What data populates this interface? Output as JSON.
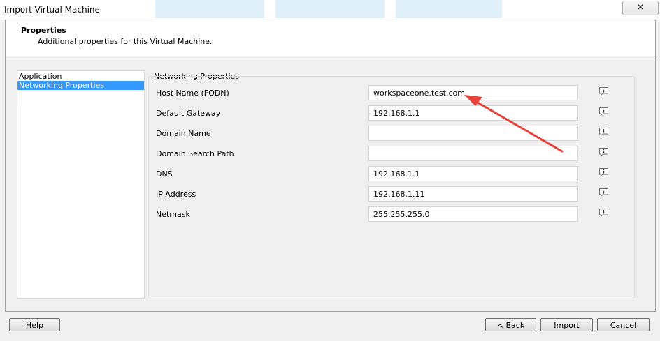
{
  "window": {
    "title": "Import Virtual Machine",
    "close_glyph": "✕"
  },
  "header": {
    "title": "Properties",
    "subtitle": "Additional properties for this Virtual Machine."
  },
  "nav": {
    "items": [
      {
        "label": "Application",
        "selected": false
      },
      {
        "label": "Networking Properties",
        "selected": true
      }
    ]
  },
  "group": {
    "label": "Networking Properties"
  },
  "fields": [
    {
      "label": "Host Name (FQDN)",
      "value": "workspaceone.test.com"
    },
    {
      "label": "Default Gateway",
      "value": "192.168.1.1"
    },
    {
      "label": "Domain Name",
      "value": ""
    },
    {
      "label": "Domain Search Path",
      "value": ""
    },
    {
      "label": "DNS",
      "value": "192.168.1.1"
    },
    {
      "label": "IP Address",
      "value": "192.168.1.11"
    },
    {
      "label": "Netmask",
      "value": "255.255.255.0"
    }
  ],
  "buttons": {
    "help": "Help",
    "back": "< Back",
    "import": "Import",
    "cancel": "Cancel"
  },
  "colors": {
    "selection": "#3399ff",
    "annotation_arrow": "#e8403a"
  }
}
